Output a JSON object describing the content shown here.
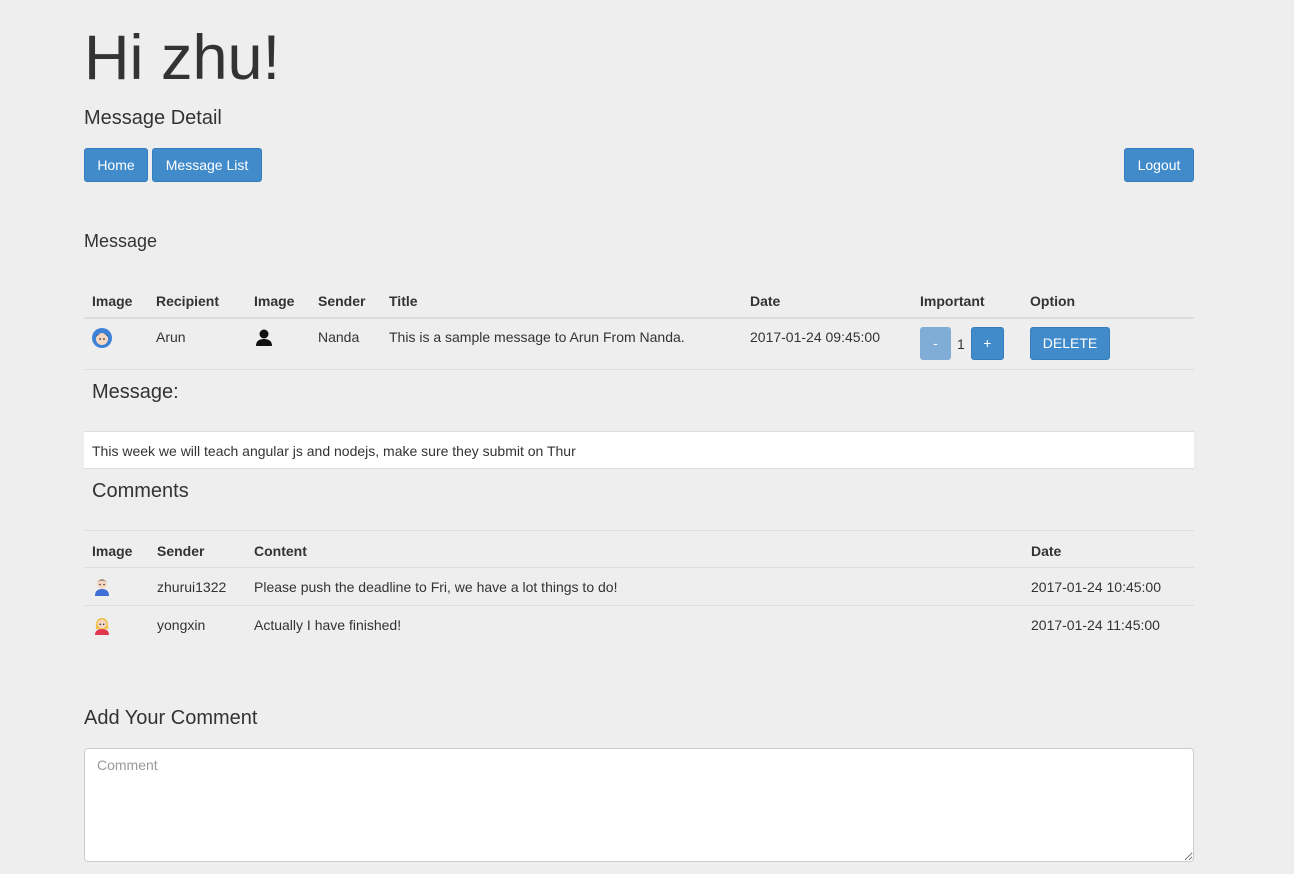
{
  "header": {
    "greeting": "Hi zhu!",
    "subtitle": "Message Detail"
  },
  "nav": {
    "home_label": "Home",
    "message_list_label": "Message List",
    "logout_label": "Logout"
  },
  "message_section": {
    "label": "Message",
    "columns": [
      "Image",
      "Recipient",
      "Image",
      "Sender",
      "Title",
      "Date",
      "Important",
      "Option"
    ],
    "row": {
      "recipient_avatar": "man-avatar-icon",
      "recipient": "Arun",
      "sender_avatar": "user-silhouette-icon",
      "sender": "Nanda",
      "title": "This is a sample message to Arun From Nanda.",
      "date": "2017-01-24 09:45:00",
      "important_value": "1",
      "minus_label": "-",
      "plus_label": "+",
      "delete_label": "DELETE"
    }
  },
  "message_content": {
    "heading": "Message:",
    "body": "This week we will teach angular js and nodejs, make sure they submit on Thur"
  },
  "comments": {
    "heading": "Comments",
    "columns": [
      "Image",
      "Sender",
      "Content",
      "Date"
    ],
    "rows": [
      {
        "avatar": "man-avatar-icon",
        "sender": "zhurui1322",
        "content": "Please push the deadline to Fri, we have a lot things to do!",
        "date": "2017-01-24 10:45:00"
      },
      {
        "avatar": "woman-avatar-icon",
        "sender": "yongxin",
        "content": "Actually I have finished!",
        "date": "2017-01-24 11:45:00"
      }
    ]
  },
  "add_comment": {
    "heading": "Add Your Comment",
    "placeholder": "Comment",
    "value": ""
  },
  "colors": {
    "primary": "#428bca",
    "primary_disabled": "#7fadd6",
    "background": "#eeeeee"
  }
}
